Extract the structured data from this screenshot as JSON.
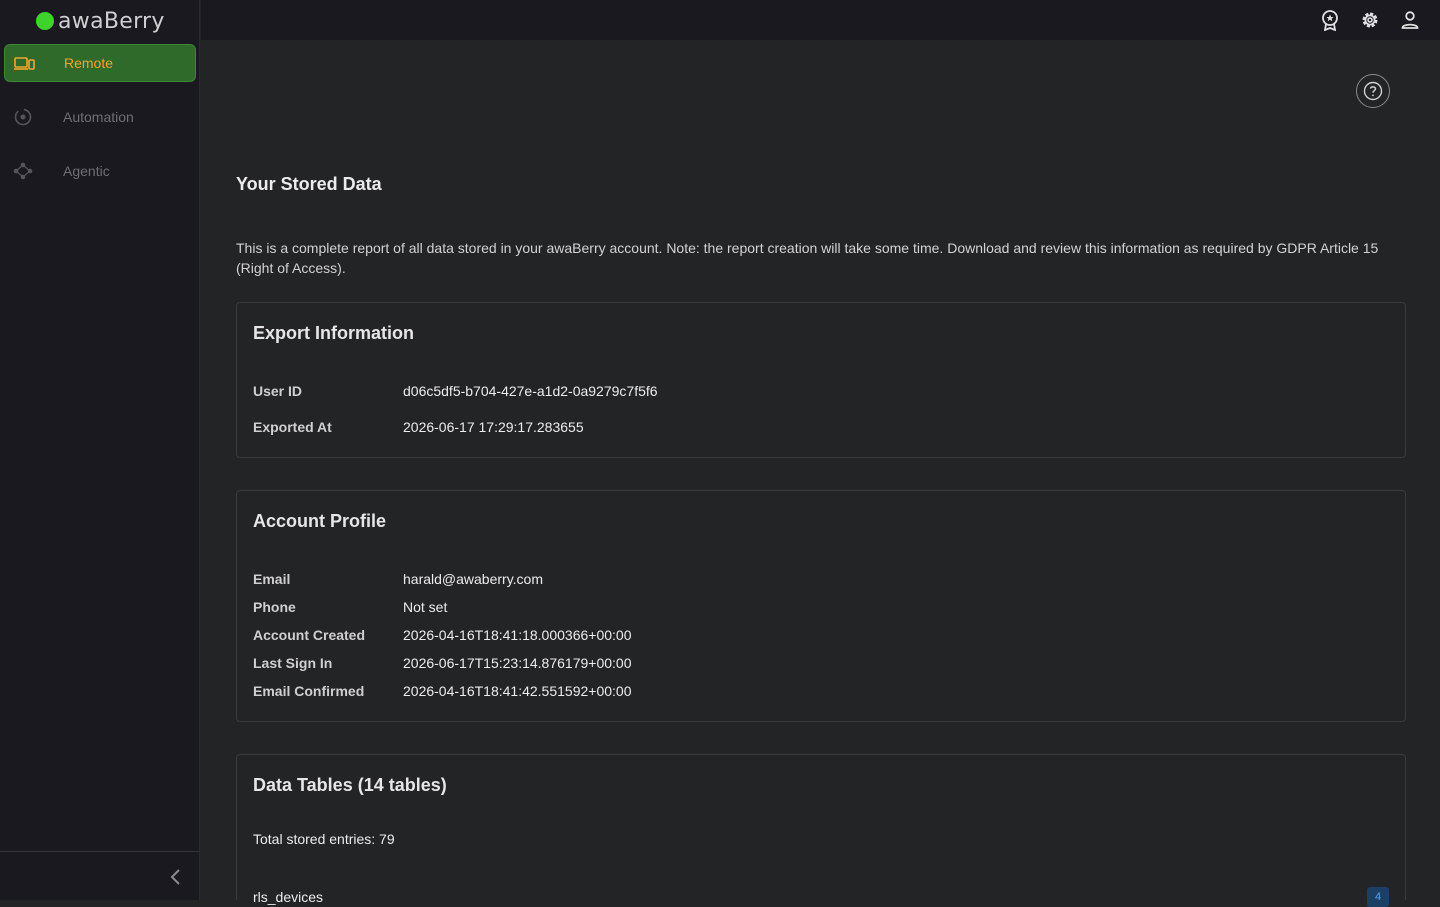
{
  "app": {
    "name": "awaBerry"
  },
  "sidebar": {
    "items": [
      {
        "label": "Remote",
        "icon": "devices-icon",
        "active": true
      },
      {
        "label": "Automation",
        "icon": "automation-icon",
        "active": false
      },
      {
        "label": "Agentic",
        "icon": "agentic-icon",
        "active": false
      }
    ]
  },
  "topbar": {
    "icons": [
      "award-icon",
      "gear-icon",
      "user-icon"
    ]
  },
  "page": {
    "title": "Your Stored Data",
    "intro": "This is a complete report of all data stored in your awaBerry account. Note: the report creation will take some time. Download and review this information as required by GDPR Article 15 (Right of Access)."
  },
  "export_info": {
    "title": "Export Information",
    "fields": [
      {
        "label": "User ID",
        "value": "d06c5df5-b704-427e-a1d2-0a9279c7f5f6"
      },
      {
        "label": "Exported At",
        "value": "2026-06-17 17:29:17.283655"
      }
    ]
  },
  "account_profile": {
    "title": "Account Profile",
    "fields": [
      {
        "label": "Email",
        "value": "harald@awaberry.com"
      },
      {
        "label": "Phone",
        "value": "Not set"
      },
      {
        "label": "Account Created",
        "value": "2026-04-16T18:41:18.000366+00:00"
      },
      {
        "label": "Last Sign In",
        "value": "2026-06-17T15:23:14.876179+00:00"
      },
      {
        "label": "Email Confirmed",
        "value": "2026-04-16T18:41:42.551592+00:00"
      }
    ]
  },
  "data_tables": {
    "title": "Data Tables (14 tables)",
    "total": "Total stored entries: 79",
    "first_table": {
      "name": "rls_devices",
      "count": "4"
    }
  },
  "colors": {
    "accent_green": "#2f6a2a",
    "active_text": "#f1a532",
    "logo_dot": "#3fd22d",
    "badge_bg": "#1c3f66"
  }
}
